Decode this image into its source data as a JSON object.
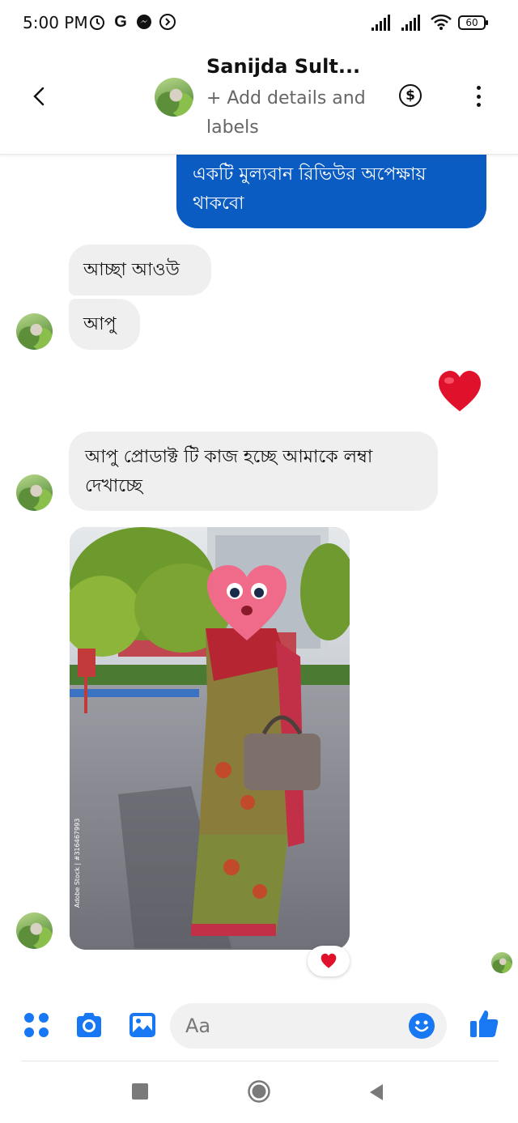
{
  "status_bar": {
    "time": "5:00 PM",
    "battery": "60",
    "icons": [
      "alarm-icon",
      "google-g-icon",
      "messenger-icon",
      "data-saver-icon",
      "signal-icon",
      "wifi-icon",
      "battery-icon"
    ]
  },
  "header": {
    "name": "Sanijda Sult...",
    "subtitle": "+ Add details and labels",
    "icons": [
      "back-arrow-icon",
      "dollar-icon",
      "more-options-icon"
    ]
  },
  "messages": {
    "sent_1": "একটি মুল্যবান রিভিউর অপেক্ষায় থাকবো",
    "received_1": "আচ্ছা আওউ",
    "received_2": "আপু",
    "sent_reaction": "heart-emoji",
    "received_3": "আপু প্রোডাক্ট টি কাজ হচ্ছে আমাকে লম্বা দেখাচ্ছে",
    "received_image_caption": "",
    "image_reaction": "heart-emoji"
  },
  "composer": {
    "placeholder": "Aa",
    "icons": [
      "apps-grid-icon",
      "camera-icon",
      "gallery-icon",
      "emoji-icon",
      "thumbs-up-icon"
    ]
  },
  "nav": {
    "icons": [
      "recents-square-icon",
      "home-circle-icon",
      "back-triangle-icon"
    ]
  },
  "colors": {
    "accent": "#1877f2",
    "sent_bubble": "#0a5bc2",
    "received_bubble": "#efefef",
    "heart": "#e0112b"
  }
}
